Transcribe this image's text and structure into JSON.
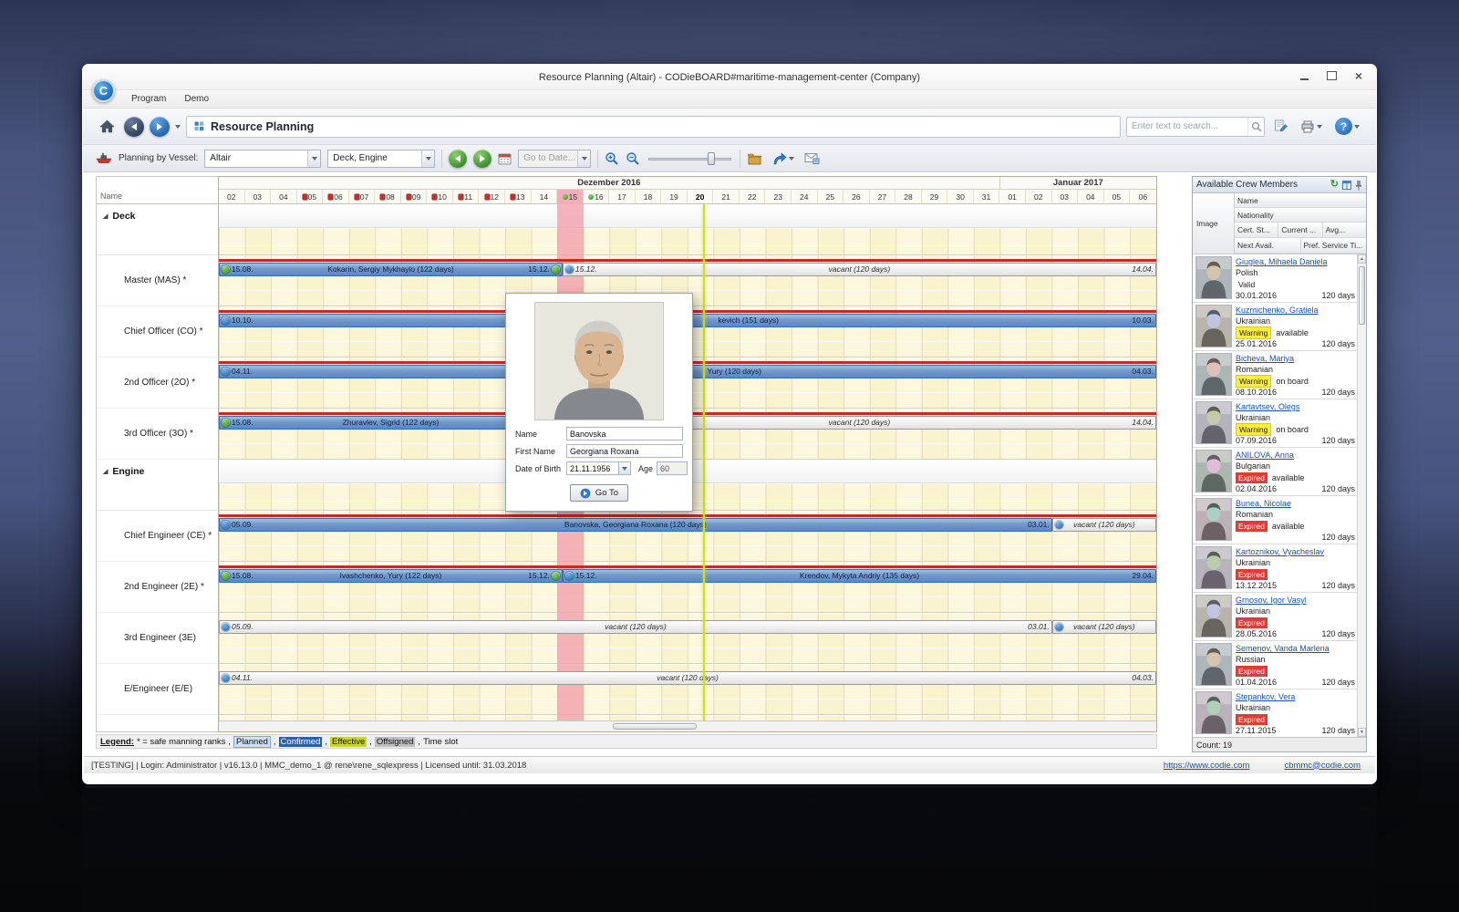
{
  "window": {
    "title": "Resource Planning (Altair) - CODieBOARD#maritime-management-center (Company)",
    "logo_letter": "C"
  },
  "menubar": {
    "items": [
      "Program",
      "Demo"
    ]
  },
  "toolbar": {
    "page_title": "Resource Planning",
    "search_placeholder": "Enter text to search..."
  },
  "planbar": {
    "vessel_label": "Planning by Vessel:",
    "vessel_value": "Altair",
    "department_value": "Deck, Engine",
    "goto_date_placeholder": "Go to Date..."
  },
  "gantt": {
    "name_header": "Name",
    "months": [
      {
        "label": "Dezember 2016",
        "cols": 30
      },
      {
        "label": "Januar 2017",
        "cols": 6
      }
    ],
    "highlight_col": 13,
    "now_col": 18.6,
    "days": [
      {
        "label": "02"
      },
      {
        "label": "03"
      },
      {
        "label": "04"
      },
      {
        "label": "05",
        "marker": "red"
      },
      {
        "label": "06",
        "marker": "red"
      },
      {
        "label": "07",
        "marker": "red"
      },
      {
        "label": "08",
        "marker": "red"
      },
      {
        "label": "09",
        "marker": "red"
      },
      {
        "label": "10",
        "marker": "red"
      },
      {
        "label": "11",
        "marker": "red"
      },
      {
        "label": "12",
        "marker": "red"
      },
      {
        "label": "13",
        "marker": "red"
      },
      {
        "label": "14"
      },
      {
        "label": "15",
        "marker": "green"
      },
      {
        "label": "16",
        "marker": "green"
      },
      {
        "label": "17"
      },
      {
        "label": "18"
      },
      {
        "label": "19"
      },
      {
        "label": "20",
        "bold": true
      },
      {
        "label": "21"
      },
      {
        "label": "22"
      },
      {
        "label": "23"
      },
      {
        "label": "24"
      },
      {
        "label": "25"
      },
      {
        "label": "26"
      },
      {
        "label": "27"
      },
      {
        "label": "28"
      },
      {
        "label": "29"
      },
      {
        "label": "30"
      },
      {
        "label": "31"
      },
      {
        "label": "01"
      },
      {
        "label": "02"
      },
      {
        "label": "03"
      },
      {
        "label": "04"
      },
      {
        "label": "05"
      },
      {
        "label": "06"
      }
    ],
    "rows": [
      {
        "type": "group",
        "label": "Deck"
      },
      {
        "type": "rank",
        "label": "Master (MAS) *",
        "redline": true,
        "bars": [
          {
            "kind": "planned",
            "start": 0,
            "end": 13.2,
            "start_icon": "green",
            "start_label": "15.08.",
            "label": "Kokarin, Sergiy Mykhaylo (122 days)",
            "end_label": "15.12.",
            "end_icon": "green"
          },
          {
            "kind": "vacant",
            "start": 13.2,
            "end": 36,
            "start_icon": "blue",
            "start_label": "15.12.",
            "label": "vacant (120 days)",
            "end_label": "14.04."
          }
        ]
      },
      {
        "type": "rank",
        "label": "Chief Officer (CO) *",
        "redline": true,
        "bars": [
          {
            "kind": "planned",
            "start": 0,
            "end": 36,
            "start_icon": "blue",
            "start_label": "10.10.",
            "label": "kevich (151 days)",
            "label_pos": 0.565,
            "end_label": "10.03."
          }
        ]
      },
      {
        "type": "rank",
        "label": "2nd Officer (2O) *",
        "redline": true,
        "bars": [
          {
            "kind": "planned",
            "start": 0,
            "end": 36,
            "start_icon": "blue",
            "start_label": "04.11.",
            "label": "Yury (120 days)",
            "label_pos": 0.55,
            "end_label": "04.03."
          }
        ]
      },
      {
        "type": "rank",
        "label": "3rd Officer (3O) *",
        "redline": true,
        "bars": [
          {
            "kind": "planned",
            "start": 0,
            "end": 13.2,
            "start_icon": "green",
            "start_label": "15.08.",
            "label": "Zhuravlev, Sigrid (122 days)"
          },
          {
            "kind": "vacant",
            "start": 13.2,
            "end": 36,
            "label": "vacant (120 days)",
            "end_label": "14.04."
          }
        ]
      },
      {
        "type": "group",
        "label": "Engine"
      },
      {
        "type": "rank",
        "label": "Chief Engineer (CE) *",
        "redline": true,
        "bars": [
          {
            "kind": "planned",
            "start": 0,
            "end": 32,
            "start_icon": "blue",
            "start_label": "05.09.",
            "label": "Banovska, Georgiana Roxana (120 days)",
            "end_label": "03.01."
          },
          {
            "kind": "vacant",
            "start": 32,
            "end": 36,
            "start_icon": "blue",
            "label": "vacant (120 days)"
          }
        ]
      },
      {
        "type": "rank",
        "label": "2nd Engineer (2E) *",
        "redline": true,
        "bars": [
          {
            "kind": "planned",
            "start": 0,
            "end": 13.2,
            "start_icon": "green",
            "start_label": "15.08.",
            "label": "Ivashchenko, Yury (122 days)",
            "end_label": "15.12.",
            "end_icon": "green"
          },
          {
            "kind": "planned",
            "start": 13.2,
            "end": 36,
            "start_icon": "blue",
            "start_label": "15.12.",
            "label": "Krendov, Mykyta Andriy (135 days)",
            "end_label": "29.04."
          }
        ]
      },
      {
        "type": "rank",
        "label": "3rd Engineer (3E)",
        "bars": [
          {
            "kind": "vacant",
            "start": 0,
            "end": 32,
            "start_icon": "blue",
            "start_label": "05.09.",
            "label": "vacant (120 days)",
            "end_label": "03.01."
          },
          {
            "kind": "vacant",
            "start": 32,
            "end": 36,
            "start_icon": "blue",
            "label": "vacant (120 days)"
          }
        ]
      },
      {
        "type": "rank",
        "label": "E/Engineer (E/E)",
        "bars": [
          {
            "kind": "vacant",
            "start": 0,
            "end": 36,
            "start_icon": "blue",
            "start_label": "04.11.",
            "label": "vacant (120 days)",
            "end_label": "04.03."
          }
        ]
      }
    ]
  },
  "popup": {
    "name_label": "Name",
    "name_value": "Banovska",
    "first_name_label": "First Name",
    "first_name_value": "Georgiana Roxana",
    "dob_label": "Date of Birth",
    "dob_value": "21.11.1956",
    "age_label": "Age",
    "age_value": "60",
    "goto_label": "Go To"
  },
  "crew_panel": {
    "title": "Available Crew Members",
    "header": {
      "image": "Image",
      "name": "Name",
      "nationality": "Nationality",
      "cert": "Cert. St...",
      "current": "Current ...",
      "avg": "Avg...",
      "next_avail": "Next Avail.",
      "pref_service": "Pref. Service Ti..."
    },
    "members": [
      {
        "name": "Giuglea, Mihaela Daniela",
        "nationality": "Polish",
        "cert": "Valid",
        "cert_style": "valid",
        "status": "",
        "next_avail": "30.01.2016",
        "service": "120 days"
      },
      {
        "name": "Kuzmichenko, Gratiela",
        "nationality": "Ukrainian",
        "cert": "Warning",
        "cert_style": "warning",
        "status": "available",
        "next_avail": "25.01.2016",
        "service": "120 days"
      },
      {
        "name": "Bicheva, Mariya",
        "nationality": "Romanian",
        "cert": "Warning",
        "cert_style": "warning",
        "status": "on board",
        "next_avail": "08.10.2016",
        "service": "120 days"
      },
      {
        "name": "Kartavtsev, Olegs",
        "nationality": "Ukrainian",
        "cert": "Warning",
        "cert_style": "warning",
        "status": "on board",
        "next_avail": "07.09.2016",
        "service": "120 days"
      },
      {
        "name": "ANILOVA, Anna",
        "nationality": "Bulgarian",
        "cert": "Expired",
        "cert_style": "expired",
        "status": "available",
        "next_avail": "02.04.2016",
        "service": "120 days"
      },
      {
        "name": "Bunea, Nicolae",
        "nationality": "Romanian",
        "cert": "Expired",
        "cert_style": "expired",
        "status": "available",
        "next_avail": "",
        "service": "120 days"
      },
      {
        "name": "Kartoznikov, Vyacheslav",
        "nationality": "Ukrainian",
        "cert": "Expired",
        "cert_style": "expired",
        "status": "",
        "next_avail": "13.12.2015",
        "service": "120 days"
      },
      {
        "name": "Grnosov, Igor Vasyl",
        "nationality": "Ukrainian",
        "cert": "Expired",
        "cert_style": "expired",
        "status": "",
        "next_avail": "28.05.2016",
        "service": "120 days"
      },
      {
        "name": "Semenov, Vanda Marlena",
        "nationality": "Russian",
        "cert": "Expired",
        "cert_style": "expired",
        "status": "",
        "next_avail": "01.04.2016",
        "service": "120 days"
      },
      {
        "name": "Stepankov, Vera",
        "nationality": "Ukrainian",
        "cert": "Expired",
        "cert_style": "expired",
        "status": "",
        "next_avail": "27.11.2015",
        "service": "120 days"
      }
    ],
    "count": "Count: 19"
  },
  "legend": {
    "title": "Legend:",
    "note": "* = safe manning ranks",
    "sep": ",",
    "items": [
      {
        "label": "Planned",
        "style": "planned"
      },
      {
        "label": "Confirmed",
        "style": "confirmed"
      },
      {
        "label": "Effective",
        "style": "effective"
      },
      {
        "label": "Offsigned",
        "style": "offsigned"
      }
    ],
    "suffix": "Time slot"
  },
  "statusbar": {
    "left": "[TESTING] | Login: Administrator | v16.13.0 | MMC_demo_1 @ rene\\rene_sqlexpress | Licensed until: 31.03.2018",
    "website": "https://www.codie.com",
    "email": "cbmmc@codie.com"
  }
}
